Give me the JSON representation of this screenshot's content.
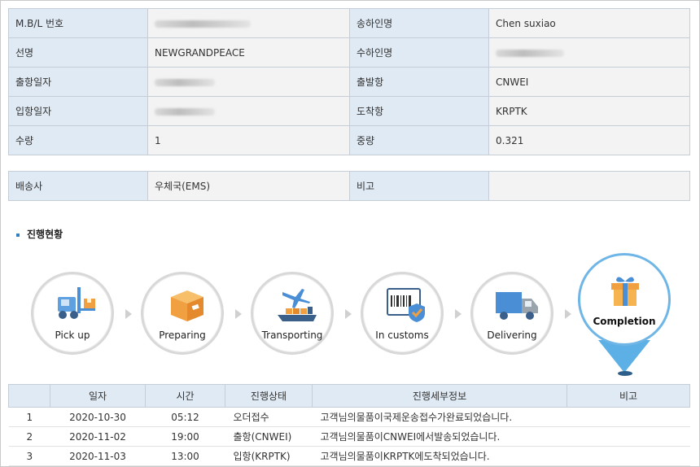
{
  "shipment_info": {
    "rows": [
      {
        "label1": "M.B/L 번호",
        "value1": "",
        "label2": "송하인명",
        "value2": "Chen suxiao"
      },
      {
        "label1": "선명",
        "value1": "NEWGRANDPEACE",
        "label2": "수하인명",
        "value2": ""
      },
      {
        "label1": "출항일자",
        "value1": "",
        "label2": "출발항",
        "value2": "CNWEI"
      },
      {
        "label1": "입항일자",
        "value1": "",
        "label2": "도착항",
        "value2": "KRPTK"
      },
      {
        "label1": "수량",
        "value1": "1",
        "label2": "중량",
        "value2": "0.321"
      }
    ]
  },
  "carrier_info": {
    "label1": "배송사",
    "value1": "우체국(EMS)",
    "label2": "비고",
    "value2": ""
  },
  "progress": {
    "section_title": "진행현황",
    "steps": [
      {
        "label": "Pick up",
        "icon": "forklift-icon"
      },
      {
        "label": "Preparing",
        "icon": "box-icon"
      },
      {
        "label": "Transporting",
        "icon": "plane-ship-icon"
      },
      {
        "label": "In customs",
        "icon": "customs-document-icon"
      },
      {
        "label": "Delivering",
        "icon": "truck-icon"
      }
    ],
    "current": {
      "label": "Completion",
      "icon": "gift-icon"
    },
    "colors": {
      "accent": "#5cb0e6",
      "icon_blue": "#4a8fd6",
      "icon_orange": "#f0a040"
    }
  },
  "history": {
    "headers": [
      "",
      "일자",
      "시간",
      "진행상태",
      "진행세부정보",
      "비고"
    ],
    "rows": [
      {
        "no": "1",
        "date": "2020-10-30",
        "time": "05:12",
        "status": "오더접수",
        "detail": "고객님의물품이국제운송접수가완료되었습니다.",
        "note": ""
      },
      {
        "no": "2",
        "date": "2020-11-02",
        "time": "19:00",
        "status": "출항(CNWEI)",
        "detail": "고객님의물품이CNWEI에서발송되었습니다.",
        "note": ""
      },
      {
        "no": "3",
        "date": "2020-11-03",
        "time": "13:00",
        "status": "입항(KRPTK)",
        "detail": "고객님의물품이KRPTK에도착되었습니다.",
        "note": ""
      }
    ]
  }
}
